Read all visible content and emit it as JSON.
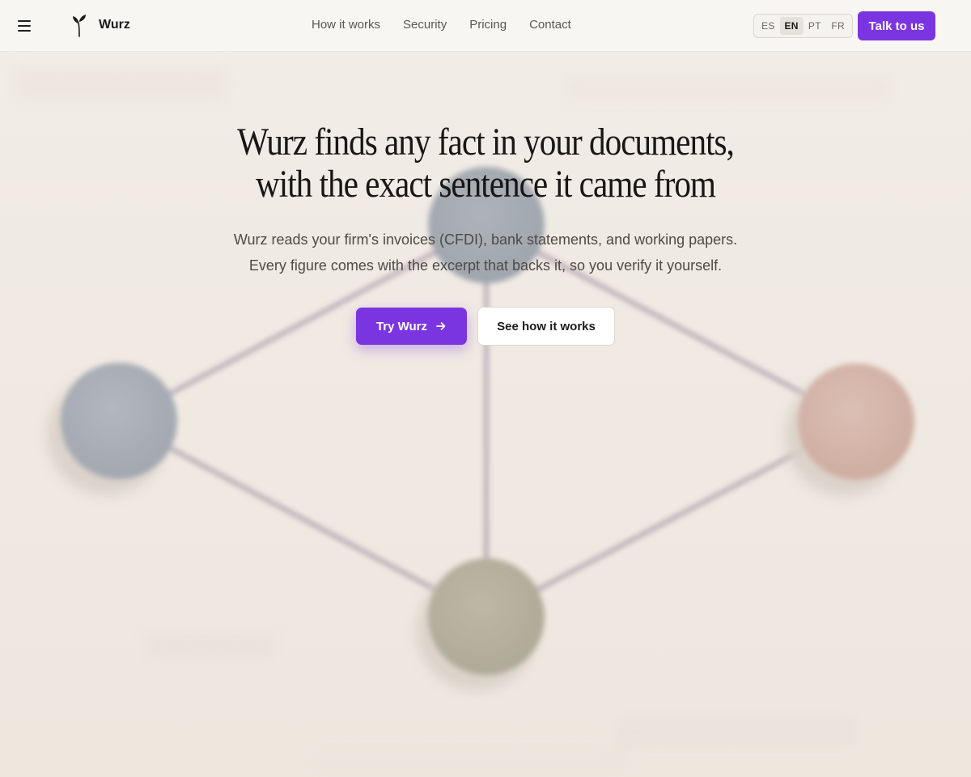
{
  "header": {
    "brand": "Wurz",
    "nav": [
      "How it works",
      "Security",
      "Pricing",
      "Contact"
    ],
    "languages": [
      "ES",
      "EN",
      "PT",
      "FR"
    ],
    "active_language": "EN",
    "cta_label": "Talk to us"
  },
  "hero": {
    "headline_line1": "Wurz finds any fact in your documents,",
    "headline_line2": "with the exact sentence it came from",
    "subtitle_line1": "Wurz reads your firm's invoices (CFDI), bank statements, and working papers.",
    "subtitle_line2": "Every figure comes with the excerpt that backs it, so you verify it yourself.",
    "primary_cta": "Try Wurz",
    "secondary_cta": "See how it works"
  },
  "colors": {
    "accent": "#7b35e0",
    "background": "#efe8e2",
    "header_bg": "#f7f6f2"
  },
  "icons": {
    "menu": "hamburger-icon",
    "logo": "sprout-icon",
    "arrow": "arrow-right-icon"
  }
}
